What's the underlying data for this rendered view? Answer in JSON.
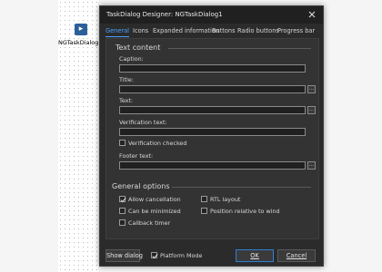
{
  "designer": {
    "component_label": "NGTaskDialog1"
  },
  "dialog": {
    "title": "TaskDialog Designer: NGTaskDialog1",
    "tabs": [
      "General",
      "Icons",
      "Expanded information",
      "Buttons",
      "Radio buttons",
      "Progress bar"
    ],
    "active_tab": "General"
  },
  "text_content": {
    "heading": "Text content",
    "caption_label": "Caption:",
    "caption_value": "",
    "title_label": "Title:",
    "title_value": "",
    "text_label": "Text:",
    "text_value": "",
    "verification_label": "Verification text:",
    "verification_value": "",
    "verification_checked_label": "Verification checked",
    "verification_checked": false,
    "footer_label": "Footer text:",
    "footer_value": "",
    "ellipsis": "..."
  },
  "general_options": {
    "heading": "General options",
    "allow_cancellation": {
      "label": "Allow cancellation",
      "checked": true
    },
    "can_be_minimized": {
      "label": "Can be minimized",
      "checked": false
    },
    "callback_timer": {
      "label": "Callback timer",
      "checked": false
    },
    "rtl_layout": {
      "label": "RTL layout",
      "checked": false
    },
    "position_relative": {
      "label": "Position relative to window",
      "checked": false
    }
  },
  "footer": {
    "show_dialog": "Show dialog",
    "platform_mode_label": "Platform Mode",
    "platform_mode_checked": true,
    "ok_label": "OK",
    "cancel_label": "Cancel"
  },
  "colors": {
    "accent": "#4aa3ff",
    "dialog_bg": "#2b2b2b",
    "panel_bg": "#333333"
  }
}
